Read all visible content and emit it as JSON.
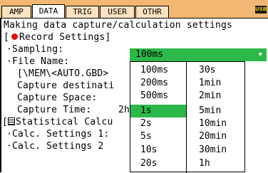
{
  "tabs": [
    {
      "label": "AMP",
      "active": false
    },
    {
      "label": "DATA",
      "active": true
    },
    {
      "label": "TRIG",
      "active": false
    },
    {
      "label": "USER",
      "active": false
    },
    {
      "label": "OTHR",
      "active": false
    }
  ],
  "usb_badge": "USB",
  "heading": "Making data capture/calculation settings",
  "record_section": {
    "label": "Record Settings]",
    "open_bracket": "[",
    "icon": "record-dot-icon",
    "sampling_label": "·Sampling:",
    "sampling_value": "100ms",
    "file_name_label": "·File Name:",
    "file_name_value": "[\\MEM\\<AUTO.GBD>",
    "capture_destination_label": "Capture destinati",
    "capture_space_label": "Capture Space:",
    "capture_time_label": "Capture Time:",
    "capture_time_value": "2h"
  },
  "stat_section": {
    "label": "Statistical Calcu",
    "icon": "statistics-icon",
    "calc1_label": "·Calc. Settings 1:",
    "calc2_label": "·Calc. Settings 2"
  },
  "sampling_options": {
    "column1": [
      "100ms",
      "200ms",
      "500ms",
      "1s",
      "2s",
      "5s",
      "10s",
      "20s"
    ],
    "column2": [
      "30s",
      "1min",
      "2min",
      "5min",
      "10min",
      "20min",
      "30min",
      "1h"
    ],
    "selected": "1s"
  },
  "colors": {
    "tabbar": "#f2b873",
    "highlight": "#2db84a",
    "record_dot": "#e01010"
  }
}
